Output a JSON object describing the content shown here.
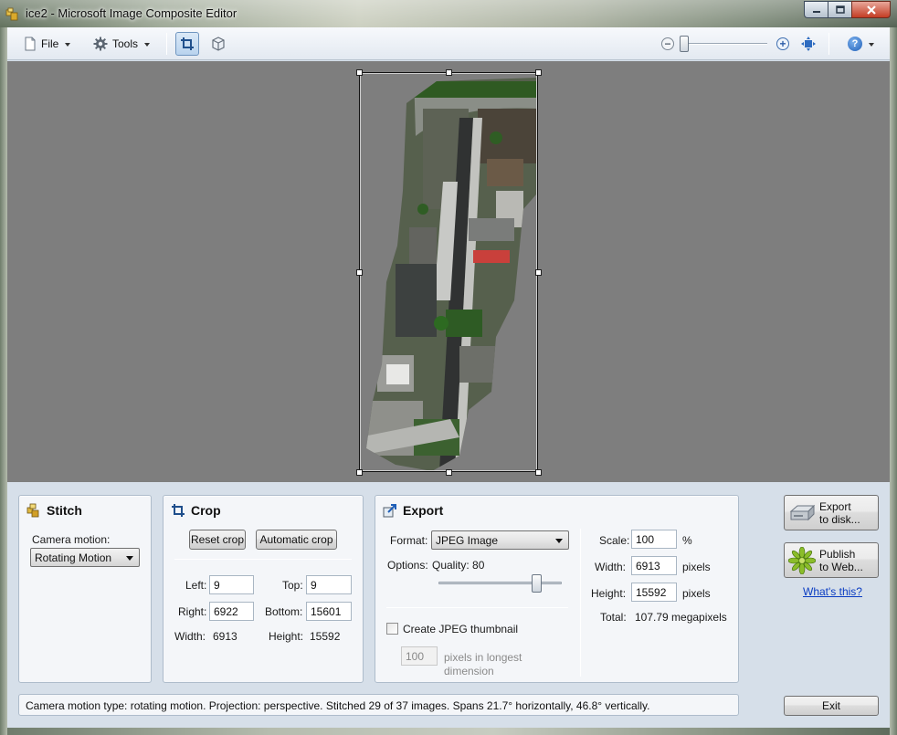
{
  "window": {
    "title": "ice2 - Microsoft Image Composite Editor"
  },
  "toolbar": {
    "file_label": "File",
    "tools_label": "Tools"
  },
  "stitch": {
    "title": "Stitch",
    "camera_motion_label": "Camera motion:",
    "camera_motion_value": "Rotating Motion"
  },
  "crop": {
    "title": "Crop",
    "reset_label": "Reset crop",
    "auto_label": "Automatic crop",
    "left_label": "Left:",
    "left_value": "9",
    "top_label": "Top:",
    "top_value": "9",
    "right_label": "Right:",
    "right_value": "6922",
    "bottom_label": "Bottom:",
    "bottom_value": "15601",
    "width_label": "Width:",
    "width_value": "6913",
    "height_label": "Height:",
    "height_value": "15592"
  },
  "export": {
    "title": "Export",
    "format_label": "Format:",
    "format_value": "JPEG Image",
    "options_label": "Options:",
    "quality_label": "Quality: 80",
    "quality_level": 80,
    "thumbnail_label": "Create JPEG thumbnail",
    "thumbnail_checked": false,
    "thumb_pixels_value": "100",
    "thumb_pixels_label_1": "pixels in longest",
    "thumb_pixels_label_2": "dimension",
    "scale_label": "Scale:",
    "scale_value": "100",
    "scale_unit": "%",
    "width_label": "Width:",
    "width_value": "6913",
    "width_unit": "pixels",
    "height_label": "Height:",
    "height_value": "15592",
    "height_unit": "pixels",
    "total_label": "Total:",
    "total_value": "107.79 megapixels"
  },
  "actions": {
    "export_disk_line1": "Export",
    "export_disk_line2": "to disk...",
    "publish_line1": "Publish",
    "publish_line2": "to Web...",
    "whats_this": "What's this?",
    "exit_label": "Exit"
  },
  "status": {
    "text": "Camera motion type: rotating motion. Projection: perspective. Stitched 29 of 37 images. Spans 21.7° horizontally, 46.8° vertically."
  }
}
